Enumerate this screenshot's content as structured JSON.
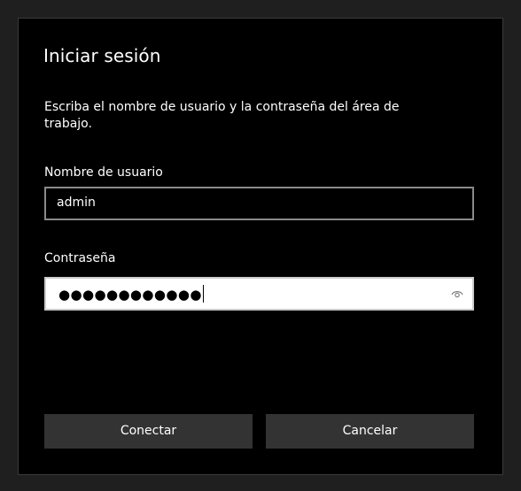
{
  "dialog": {
    "title": "Iniciar sesión",
    "description": "Escriba el nombre de usuario y la contraseña del área de trabajo.",
    "username": {
      "label": "Nombre de usuario",
      "value": "admin"
    },
    "password": {
      "label": "Contraseña",
      "masked_value": "●●●●●●●●●●●●",
      "reveal_icon": "eye-icon"
    },
    "buttons": {
      "connect": "Conectar",
      "cancel": "Cancelar"
    }
  },
  "colors": {
    "background": "#000000",
    "text": "#ffffff",
    "button": "#333333",
    "input_border": "#8a8a8a"
  }
}
